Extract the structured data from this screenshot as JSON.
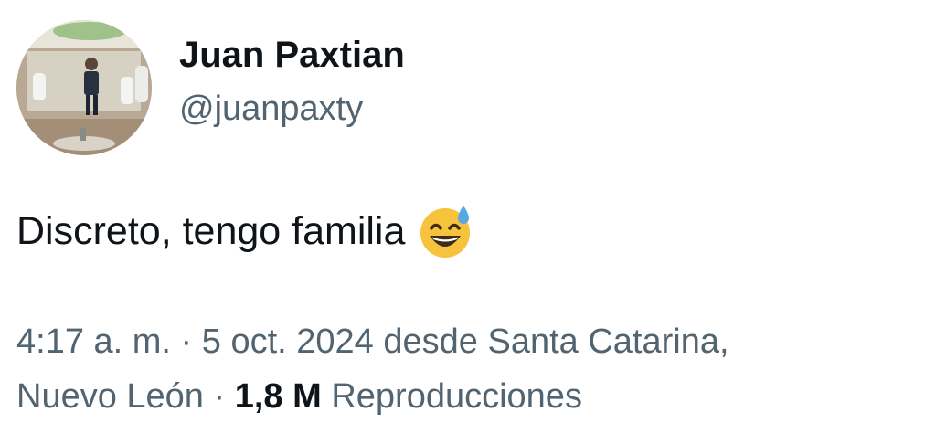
{
  "user": {
    "display_name": "Juan Paxtian",
    "handle": "@juanpaxty"
  },
  "tweet": {
    "text": "Discreto, tengo familia",
    "emoji": "grinning-face-with-sweat"
  },
  "meta": {
    "time": "4:17 a. m.",
    "separator": "·",
    "date": "5 oct. 2024",
    "location_prefix": "desde Santa Catarina,",
    "location_rest": "Nuevo León",
    "views_count": "1,8 M",
    "views_label": "Reproducciones"
  },
  "colors": {
    "text_primary": "#0f1419",
    "text_secondary": "#536471",
    "emoji_yellow": "#f7c23c",
    "sweat_blue": "#5aa7e8"
  }
}
